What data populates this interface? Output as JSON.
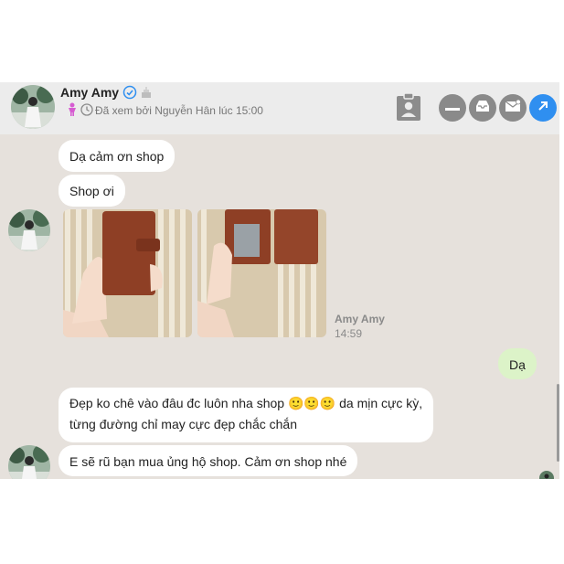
{
  "header": {
    "name": "Amy Amy",
    "seen_text": "Đã xem bởi Nguyễn Hân lúc 15:00"
  },
  "messages": [
    {
      "text": "Dạ cảm ơn shop"
    },
    {
      "text": "Shop ơi"
    },
    {
      "text": "Dạ"
    },
    {
      "line1": "Đẹp ko chê vào đâu đc luôn nha shop 🙂🙂🙂 da mịn cực kỳ,",
      "line2": "từng đường chỉ may cực đẹp chắc chắn"
    },
    {
      "text": "E sẽ rũ bạn mua ủng hộ shop. Cảm ơn shop nhé"
    }
  ],
  "photo_meta": {
    "sender": "Amy Amy",
    "time": "14:59"
  },
  "colors": {
    "chat_bg": "#e6e1dc",
    "own_bubble": "#dcf3c8",
    "accent_blue": "#2f8ff0"
  },
  "icons": [
    "verified-icon",
    "birthday-cake-icon",
    "female-icon",
    "clock-icon",
    "contact-card-icon",
    "minimize-icon",
    "inbox-icon",
    "mail-icon",
    "open-external-icon"
  ]
}
